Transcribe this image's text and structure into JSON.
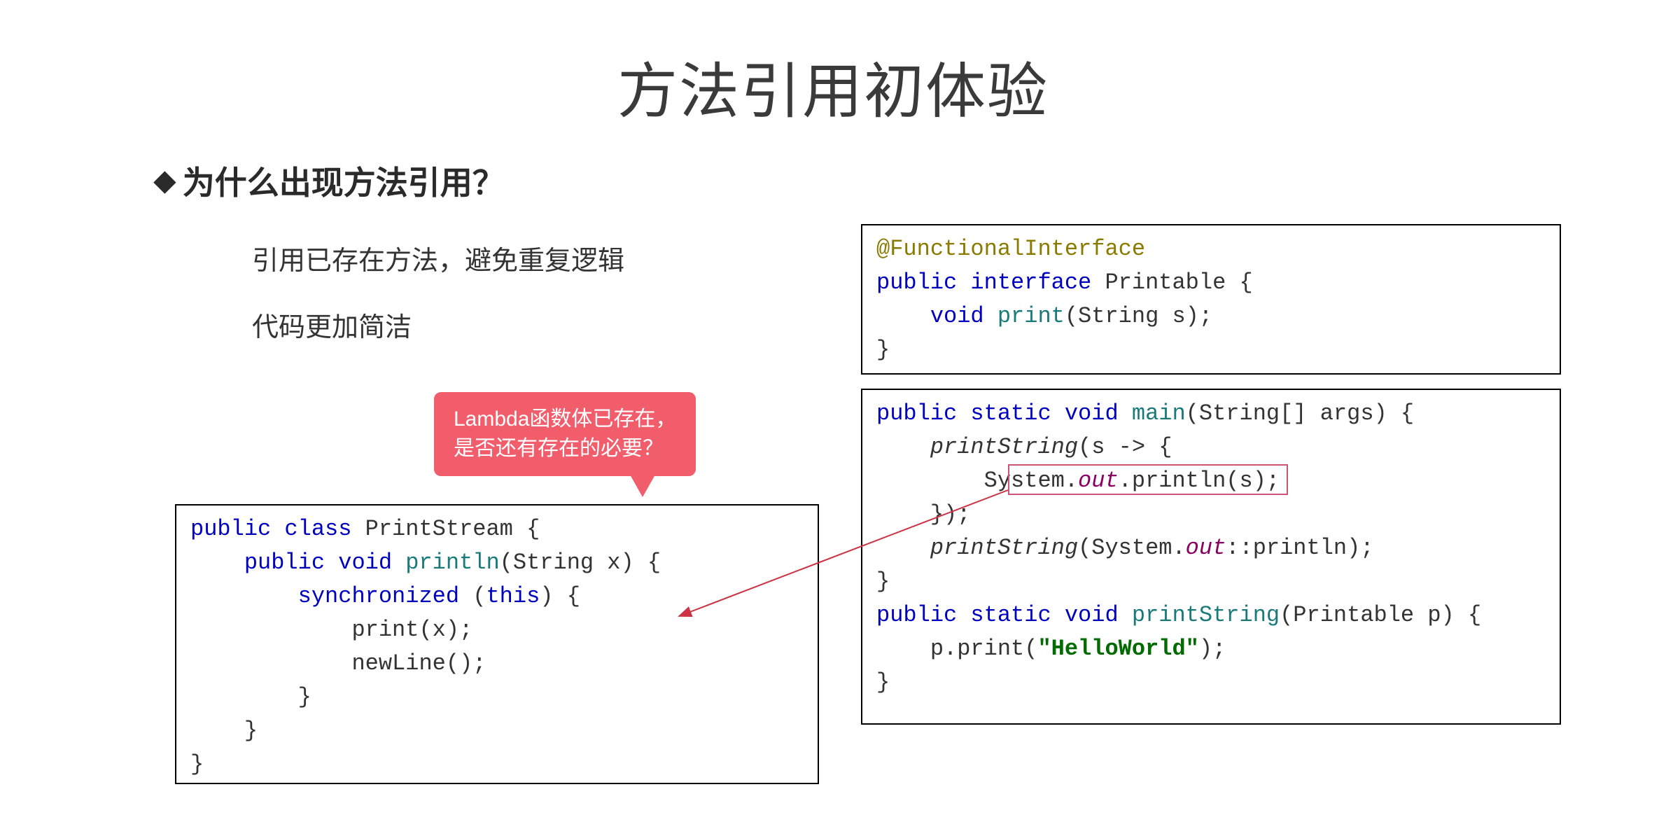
{
  "title": "方法引用初体验",
  "heading": "为什么出现方法引用？",
  "bullet1": "引用已存在方法，避免重复逻辑",
  "bullet2": "代码更加简洁",
  "callout_line1": "Lambda函数体已存在，",
  "callout_line2": "是否还有存在的必要？",
  "code_left": {
    "l1_public": "public",
    "l1_class": "class",
    "l1_name": "PrintStream {",
    "l2_public": "public",
    "l2_void": "void",
    "l2_method": "println",
    "l2_params": "(String x) {",
    "l3_sync": "synchronized",
    "l3_this": "this",
    "l3_open": " (",
    "l3_close": ") {",
    "l4": "            print(x);",
    "l5": "            newLine();",
    "l6": "        }",
    "l7": "    }",
    "l8": "}"
  },
  "code_top": {
    "l1": "@FunctionalInterface",
    "l2_public": "public",
    "l2_interface": "interface",
    "l2_name": "Printable {",
    "l3_void": "void",
    "l3_method": "print",
    "l3_params": "(String s);",
    "l4": "}"
  },
  "code_bottom": {
    "l1_public": "public",
    "l1_static": "static",
    "l1_void": "void",
    "l1_method": "main",
    "l1_params": "(String[] args) {",
    "l2_call": "printString",
    "l2_rest": "(s -> {",
    "l3_sys": "        System.",
    "l3_out": "out",
    "l3_println": ".println(s);",
    "l4": "    });",
    "l5_call": "printString",
    "l5_sys": "(System.",
    "l5_out": "out",
    "l5_rest": "::println);",
    "l6": "}",
    "l7_public": "public",
    "l7_static": "static",
    "l7_void": "void",
    "l7_method": "printString",
    "l7_params": "(Printable p) {",
    "l8_pre": "    p.print(",
    "l8_str": "\"HelloWorld\"",
    "l8_post": ");",
    "l9": "}"
  }
}
